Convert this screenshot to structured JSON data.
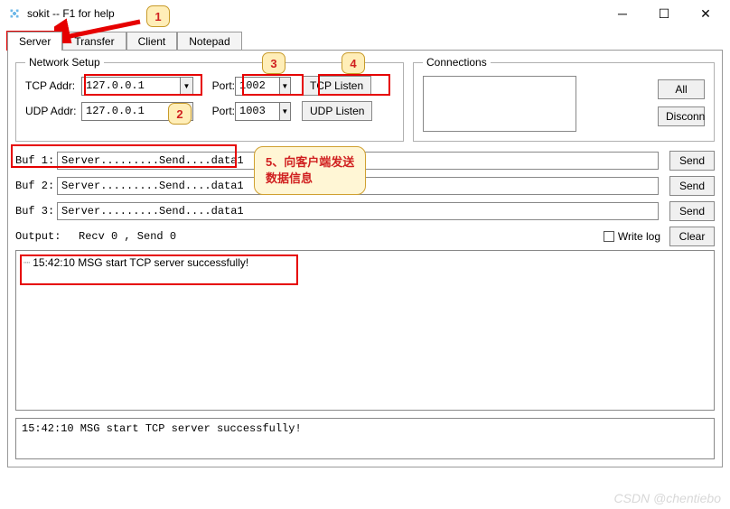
{
  "window": {
    "title": "sokit -- F1 for help"
  },
  "tabs": {
    "server": "Server",
    "transfer": "Transfer",
    "client": "Client",
    "notepad": "Notepad"
  },
  "network": {
    "legend": "Network Setup",
    "tcp_label": "TCP Addr:",
    "udp_label": "UDP Addr:",
    "port_label": "Port:",
    "tcp_addr": "127.0.0.1",
    "tcp_port": "1002",
    "udp_addr": "127.0.0.1",
    "udp_port": "1003",
    "tcp_listen": "TCP Listen",
    "udp_listen": "UDP Listen"
  },
  "connections": {
    "legend": "Connections",
    "all": "All",
    "disconn": "Disconn"
  },
  "bufs": {
    "b1_label": "Buf 1:",
    "b2_label": "Buf 2:",
    "b3_label": "Buf 3:",
    "b1": "Server.........Send....data1",
    "b2": "Server.........Send....data1",
    "b3": "Server.........Send....data1",
    "send": "Send"
  },
  "output": {
    "label": "Output:",
    "stats": "Recv 0 , Send 0",
    "writelog": "Write log",
    "clear": "Clear",
    "logline": "15:42:10 MSG start TCP server successfully!"
  },
  "bottom": {
    "text": "15:42:10 MSG start TCP server successfully!"
  },
  "annot": {
    "b1": "1",
    "b2": "2",
    "b3": "3",
    "b4": "4",
    "note5_l1": "5、向客户端发送",
    "note5_l2": "数据信息"
  },
  "watermark": "CSDN @chentiebo"
}
